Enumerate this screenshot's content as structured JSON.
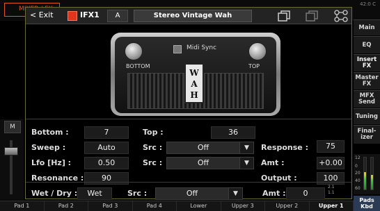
{
  "background": {
    "mixer_tab_label": "MIXER / FX",
    "clock": "42:0 C",
    "left_strip_button": "M",
    "right_panel": [
      {
        "label": "Main"
      },
      {
        "label": "EQ"
      },
      {
        "label": "Insert FX",
        "active": true
      },
      {
        "label": "Master FX"
      },
      {
        "label": "MFX Send"
      },
      {
        "label": "Tuning"
      },
      {
        "label": "Final-izer"
      }
    ],
    "meter_scale": [
      "12",
      "0",
      "20",
      "40",
      "60"
    ],
    "meter_levels": [
      0.55,
      0.45
    ],
    "pads_kbd_label": "Pads Kbd",
    "bottom_tabs": [
      "Pad 1",
      "Pad 2",
      "Pad 3",
      "Pad 4",
      "Lower",
      "Upper 3",
      "Upper 2",
      "Upper 1"
    ]
  },
  "dialog": {
    "exit_label": "< Exit",
    "fx_slot": "IFX1",
    "variation": "A",
    "effect_name": "Stereo Vintage Wah",
    "icons": [
      "copy-icon",
      "paste-icon",
      "routing-icon"
    ],
    "colors": {
      "accent": "#e1351b",
      "frame": "#6b6b3a"
    }
  },
  "pedal": {
    "midi_sync_label": "Midi Sync",
    "bottom_label": "BOTTOM",
    "top_label": "TOP",
    "badge_letters": [
      "W",
      "A",
      "H"
    ]
  },
  "params": {
    "bottom": {
      "label": "Bottom :",
      "value": "7"
    },
    "top": {
      "label": "Top :",
      "value": "36"
    },
    "sweep": {
      "label": "Sweep :",
      "value": "Auto"
    },
    "src1": {
      "label": "Src :",
      "value": "Off"
    },
    "response": {
      "label": "Response :",
      "value": "75"
    },
    "lfo": {
      "label": "Lfo [Hz] :",
      "value": "0.50"
    },
    "src2": {
      "label": "Src :",
      "value": "Off"
    },
    "amt1": {
      "label": "Amt :",
      "value": "+0.00"
    },
    "resonance": {
      "label": "Resonance :",
      "value": "90"
    },
    "output": {
      "label": "Output :",
      "value": "100"
    },
    "wetdry": {
      "label": "Wet / Dry :",
      "value": "Wet"
    },
    "src3": {
      "label": "Src :",
      "value": "Off"
    },
    "amt2": {
      "label": "Amt :",
      "value": "0"
    },
    "mini_meter": [
      "2.1",
      "1.1"
    ]
  }
}
